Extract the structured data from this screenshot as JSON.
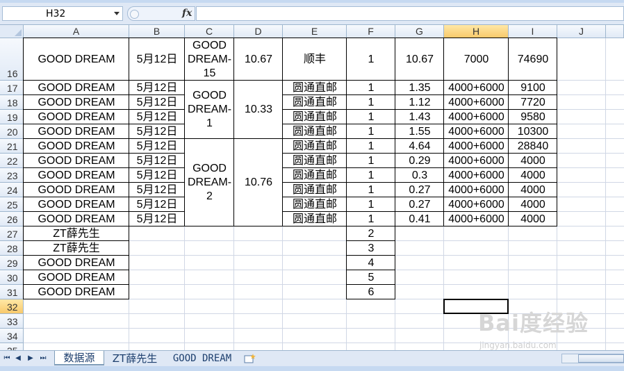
{
  "name_box": {
    "value": "H32"
  },
  "formula_bar": {
    "fx_label": "fx",
    "value": ""
  },
  "column_headers": [
    "A",
    "B",
    "C",
    "D",
    "E",
    "F",
    "G",
    "H",
    "I",
    "J"
  ],
  "row_headers": [
    "16",
    "17",
    "18",
    "19",
    "20",
    "21",
    "22",
    "23",
    "24",
    "25",
    "26",
    "27",
    "28",
    "29",
    "30",
    "31",
    "32",
    "33",
    "34",
    "35"
  ],
  "selected_cell": "H32",
  "cells": {
    "r16": {
      "A": "GOOD DREAM",
      "B": "5月12日",
      "C": "GOOD DREAM-15",
      "D": "10.67",
      "E": "顺丰",
      "F": "1",
      "G": "10.67",
      "H": "7000",
      "I": "74690"
    },
    "r17": {
      "A": "GOOD DREAM",
      "B": "5月12日",
      "E": "圆通直邮",
      "F": "1",
      "G": "1.35",
      "H": "4000+6000",
      "I": "9100"
    },
    "r18": {
      "A": "GOOD DREAM",
      "B": "5月12日",
      "E": "圆通直邮",
      "F": "1",
      "G": "1.12",
      "H": "4000+6000",
      "I": "7720"
    },
    "r19": {
      "A": "GOOD DREAM",
      "B": "5月12日",
      "E": "圆通直邮",
      "F": "1",
      "G": "1.43",
      "H": "4000+6000",
      "I": "9580"
    },
    "r20": {
      "A": "GOOD DREAM",
      "B": "5月12日",
      "E": "圆通直邮",
      "F": "1",
      "G": "1.55",
      "H": "4000+6000",
      "I": "10300"
    },
    "r21": {
      "A": "GOOD DREAM",
      "B": "5月12日",
      "E": "圆通直邮",
      "F": "1",
      "G": "4.64",
      "H": "4000+6000",
      "I": "28840"
    },
    "r22": {
      "A": "GOOD DREAM",
      "B": "5月12日",
      "E": "圆通直邮",
      "F": "1",
      "G": "0.29",
      "H": "4000+6000",
      "I": "4000"
    },
    "r23": {
      "A": "GOOD DREAM",
      "B": "5月12日",
      "E": "圆通直邮",
      "F": "1",
      "G": "0.3",
      "H": "4000+6000",
      "I": "4000"
    },
    "r24": {
      "A": "GOOD DREAM",
      "B": "5月12日",
      "E": "圆通直邮",
      "F": "1",
      "G": "0.27",
      "H": "4000+6000",
      "I": "4000"
    },
    "r25": {
      "A": "GOOD DREAM",
      "B": "5月12日",
      "E": "圆通直邮",
      "F": "1",
      "G": "0.27",
      "H": "4000+6000",
      "I": "4000"
    },
    "r26": {
      "A": "GOOD DREAM",
      "B": "5月12日",
      "E": "圆通直邮",
      "F": "1",
      "G": "0.41",
      "H": "4000+6000",
      "I": "4000"
    },
    "r27": {
      "A": "ZT薛先生",
      "F": "2"
    },
    "r28": {
      "A": "ZT薛先生",
      "F": "3"
    },
    "r29": {
      "A": "GOOD DREAM",
      "F": "4"
    },
    "r30": {
      "A": "GOOD DREAM",
      "F": "5"
    },
    "r31": {
      "A": "GOOD DREAM",
      "F": "6"
    },
    "merged": {
      "c17_20": "GOOD DREAM-1",
      "d17_20": "10.33",
      "c21_26": "GOOD DREAM-2",
      "d21_26": "10.76"
    }
  },
  "sheet_tabs": [
    {
      "label": "数据源",
      "active": true
    },
    {
      "label": "ZT薛先生",
      "active": false
    },
    {
      "label": "GOOD DREAM",
      "active": false
    }
  ],
  "watermark": {
    "brand": "Bai度经验",
    "url": "jingyan.baidu.com"
  }
}
